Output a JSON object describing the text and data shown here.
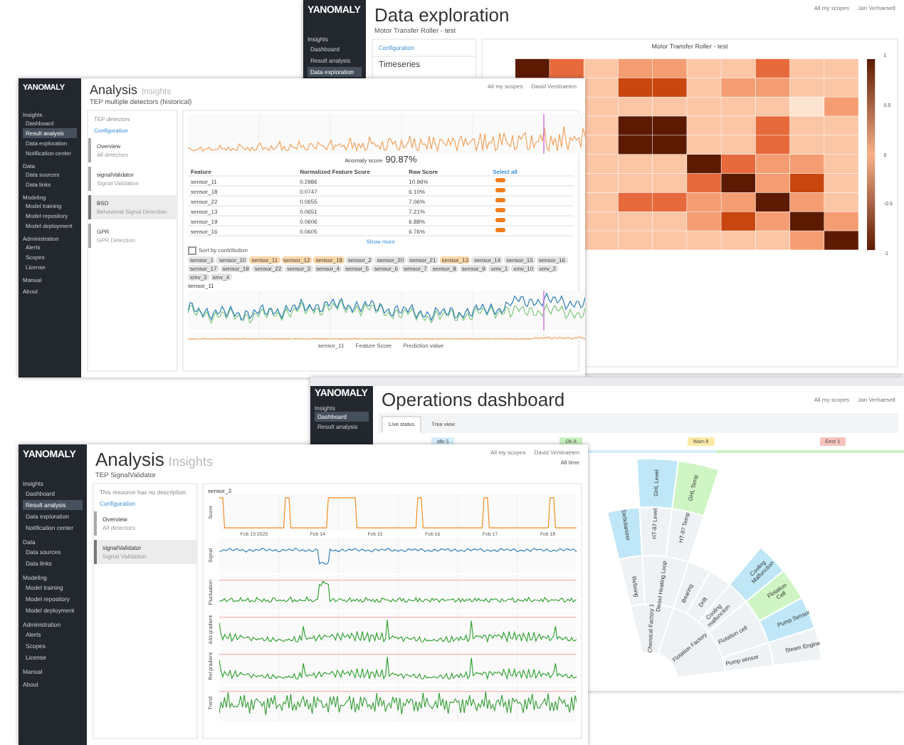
{
  "windows": [
    {
      "kind": "exploration",
      "logo": "YANOMALY",
      "nav": [
        {
          "kind": "heading",
          "label": "Insights"
        },
        {
          "kind": "item",
          "label": "Dashboard",
          "selected": false
        },
        {
          "kind": "item",
          "label": "Result analysis",
          "selected": false
        },
        {
          "kind": "item",
          "label": "Data exploration",
          "selected": true
        }
      ],
      "title": "Data exploration",
      "subtitle": "Motor Transfer Roller - test",
      "scopes": "All my scopes",
      "user": "Jan Verhaeselt",
      "panel": {
        "configuration": "Configuration",
        "section": "Timeseries"
      },
      "chart_title": "Motor Transfer Roller - test",
      "colorbar_ticks": [
        "1",
        "0.5",
        "0",
        "-0.5",
        "-1"
      ]
    },
    {
      "kind": "detectors",
      "logo": "YANOMALY",
      "nav": [
        {
          "kind": "heading",
          "label": "Insights"
        },
        {
          "kind": "item",
          "label": "Dashboard",
          "selected": false
        },
        {
          "kind": "item",
          "label": "Result analysis",
          "selected": true
        },
        {
          "kind": "item",
          "label": "Data exploration",
          "selected": false
        },
        {
          "kind": "item",
          "label": "Notification center",
          "selected": false
        },
        {
          "kind": "heading",
          "label": "Data"
        },
        {
          "kind": "item",
          "label": "Data sources",
          "selected": false
        },
        {
          "kind": "item",
          "label": "Data links",
          "selected": false
        },
        {
          "kind": "heading",
          "label": "Modeling"
        },
        {
          "kind": "item",
          "label": "Model training",
          "selected": false
        },
        {
          "kind": "item",
          "label": "Model repository",
          "selected": false
        },
        {
          "kind": "item",
          "label": "Model deployment",
          "selected": false
        },
        {
          "kind": "heading",
          "label": "Administration"
        },
        {
          "kind": "item",
          "label": "Alerts",
          "selected": false
        },
        {
          "kind": "item",
          "label": "Scopes",
          "selected": false
        },
        {
          "kind": "item",
          "label": "License",
          "selected": false
        },
        {
          "kind": "heading",
          "label": "Manual"
        },
        {
          "kind": "heading",
          "label": "About"
        }
      ],
      "title": "Analysis",
      "title_note": "Insights",
      "subtitle": "TEP multiple detectors (historical)",
      "scopes": "All my scopes",
      "user": "David Verstraeten",
      "panel": {
        "description": "TEP detectors",
        "configuration": "Configuration",
        "detectors": [
          {
            "name": "Overview",
            "detail": "All detectors",
            "selected": false
          },
          {
            "name": "signalValidator",
            "detail": "Signal Validation",
            "selected": false
          },
          {
            "name": "BSD",
            "detail": "Behavioral Signal Detection",
            "selected": true
          },
          {
            "name": "GPR",
            "detail": "GPR Detection",
            "selected": false
          }
        ]
      },
      "score_label": "Anomaly score",
      "score": "90.87%",
      "table": {
        "columns": [
          "Feature",
          "Normalized Feature Score",
          "Raw Score",
          "Select all"
        ],
        "rows": [
          {
            "feature": "sensor_11",
            "norm": "0.2986",
            "raw": "10.96%",
            "on": true
          },
          {
            "feature": "sensor_18",
            "norm": "0.0747",
            "raw": "6.10%",
            "on": true
          },
          {
            "feature": "sensor_22",
            "norm": "0.0655",
            "raw": "7.06%",
            "on": true
          },
          {
            "feature": "sensor_13",
            "norm": "0.0651",
            "raw": "7.21%",
            "on": true
          },
          {
            "feature": "sensor_19",
            "norm": "0.0606",
            "raw": "6.88%",
            "on": true
          },
          {
            "feature": "sensor_16",
            "norm": "0.0605",
            "raw": "6.76%",
            "on": true
          }
        ]
      },
      "show_more": "Show more",
      "sort": {
        "label": "Sort by contribution",
        "checked": false
      },
      "chips": [
        {
          "label": "sensor_1",
          "selected": false
        },
        {
          "label": "sensor_10",
          "selected": false
        },
        {
          "label": "sensor_11",
          "selected": true
        },
        {
          "label": "sensor_12",
          "selected": true
        },
        {
          "label": "sensor_18",
          "selected": true
        },
        {
          "label": "sensor_2",
          "selected": false
        },
        {
          "label": "sensor_20",
          "selected": false
        },
        {
          "label": "sensor_21",
          "selected": false
        },
        {
          "label": "sensor_13",
          "selected": true
        },
        {
          "label": "sensor_14",
          "selected": false
        },
        {
          "label": "sensor_15",
          "selected": false
        },
        {
          "label": "sensor_16",
          "selected": false
        },
        {
          "label": "sensor_17",
          "selected": false
        },
        {
          "label": "sensor_19",
          "selected": false
        },
        {
          "label": "sensor_22",
          "selected": false
        },
        {
          "label": "sensor_3",
          "selected": false
        },
        {
          "label": "sensor_4",
          "selected": false
        },
        {
          "label": "sensor_5",
          "selected": false
        },
        {
          "label": "sensor_6",
          "selected": false
        },
        {
          "label": "sensor_7",
          "selected": false
        },
        {
          "label": "sensor_8",
          "selected": false
        },
        {
          "label": "sensor_9",
          "selected": false
        },
        {
          "label": "xmv_1",
          "selected": false
        },
        {
          "label": "xmv_10",
          "selected": false
        },
        {
          "label": "xmv_2",
          "selected": false
        },
        {
          "label": "xmv_3",
          "selected": false
        },
        {
          "label": "xmv_4",
          "selected": false
        }
      ],
      "sensor_title": "sensor_11",
      "legend": [
        "sensor_11",
        "Feature Score",
        "Prediction value"
      ]
    },
    {
      "kind": "operations",
      "logo": "YANOMALY",
      "nav": [
        {
          "kind": "heading",
          "label": "Insights"
        },
        {
          "kind": "item",
          "label": "Dashboard",
          "selected": true
        },
        {
          "kind": "item",
          "label": "Result analysis",
          "selected": false
        }
      ],
      "title": "Operations dashboard",
      "scopes": "All my scopes",
      "user": "Jan Verhaeselt",
      "tabs": [
        {
          "label": "Live status",
          "selected": true
        },
        {
          "label": "Tree view",
          "selected": false
        }
      ],
      "statuses": [
        {
          "label": "Idle 5",
          "color": "#d6eefb"
        },
        {
          "label": "OK 8",
          "color": "#c9f2c0"
        },
        {
          "label": "Warn 8",
          "color": "#fbe9a8"
        },
        {
          "label": "Error 1",
          "color": "#f6c2bb"
        }
      ],
      "sunburst": [
        {
          "label": "Flotation Factory",
          "color": "#eef2f4",
          "children": [
            {
              "label": "Pump sensor",
              "color": "#eef2f4",
              "children": [
                {
                  "label": "Steam Engine",
                  "color": "#eef2f4"
                }
              ]
            },
            {
              "label": "Flotation cell",
              "color": "#eef2f4",
              "children": [
                {
                  "label": "Pump Sensor",
                  "color": "#bfe7f7"
                },
                {
                  "label": "Flotation Cell",
                  "color": "#cff5c4"
                }
              ]
            },
            {
              "label": "Cooling malfunction",
              "color": "#eef2f4",
              "children": [
                {
                  "label": "Cooling Malfunction",
                  "color": "#bfe7f7"
                }
              ]
            },
            {
              "label": "Drift",
              "color": "#eef2f4"
            },
            {
              "label": "Bearing",
              "color": "#eef2f4"
            }
          ]
        },
        {
          "label": "Chemical Factory 1",
          "color": "#eef2f4",
          "children": [
            {
              "label": "Diesel Heating Loop",
              "color": "#eef2f4",
              "children": [
                {
                  "label": "HT-87 Temp",
                  "color": "#eef2f4",
                  "children": [
                    {
                      "label": "GHL Temp",
                      "color": "#cff5c4"
                    }
                  ]
                },
                {
                  "label": "HT-87 Level",
                  "color": "#eef2f4",
                  "children": [
                    {
                      "label": "GHL Level",
                      "color": "#bfe7f7"
                    }
                  ]
                }
              ]
            },
            {
              "label": "Refining",
              "color": "#eef2f4",
              "children": [
                {
                  "label": "Debutanizer",
                  "color": "#bfe7f7"
                }
              ]
            }
          ]
        }
      ]
    },
    {
      "kind": "validator",
      "logo": "YANOMALY",
      "nav": [
        {
          "kind": "heading",
          "label": "Insights"
        },
        {
          "kind": "item",
          "label": "Dashboard",
          "selected": false
        },
        {
          "kind": "item",
          "label": "Result analysis",
          "selected": true
        },
        {
          "kind": "item",
          "label": "Data exploration",
          "selected": false
        },
        {
          "kind": "item",
          "label": "Notification center",
          "selected": false
        },
        {
          "kind": "heading",
          "label": "Data"
        },
        {
          "kind": "item",
          "label": "Data sources",
          "selected": false
        },
        {
          "kind": "item",
          "label": "Data links",
          "selected": false
        },
        {
          "kind": "heading",
          "label": "Modeling"
        },
        {
          "kind": "item",
          "label": "Model training",
          "selected": false
        },
        {
          "kind": "item",
          "label": "Model repository",
          "selected": false
        },
        {
          "kind": "item",
          "label": "Model deployment",
          "selected": false
        },
        {
          "kind": "heading",
          "label": "Administration"
        },
        {
          "kind": "item",
          "label": "Alerts",
          "selected": false
        },
        {
          "kind": "item",
          "label": "Scopes",
          "selected": false
        },
        {
          "kind": "item",
          "label": "License",
          "selected": false
        },
        {
          "kind": "heading",
          "label": "Manual"
        },
        {
          "kind": "heading",
          "label": "About"
        }
      ],
      "title": "Analysis",
      "title_note": "Insights",
      "subtitle": "TEP SignalValidator",
      "scopes": "All my scopes",
      "user": "David Verstraeten",
      "range": "All time",
      "panel": {
        "description": "This resource has no description.",
        "configuration": "Configuration",
        "detectors": [
          {
            "name": "Overview",
            "detail": "All detectors",
            "selected": false
          },
          {
            "name": "signalValidator",
            "detail": "Signal Validation",
            "selected": true
          }
        ]
      },
      "chart_title": "sensor_3",
      "x_ticks": [
        "Feb 13 2020",
        "Feb 14",
        "Feb 15",
        "Feb 16",
        "Feb 17",
        "Feb 18"
      ],
      "panels": [
        {
          "label": "Score",
          "kind": "step"
        },
        {
          "label": "Signal",
          "kind": "signal"
        },
        {
          "label": "Fluctuation",
          "kind": "noise"
        },
        {
          "label": "Abs gradient",
          "kind": "spiky"
        },
        {
          "label": "Rel gradient",
          "kind": "spiky"
        },
        {
          "label": "Trend",
          "kind": "wave"
        }
      ]
    }
  ]
}
